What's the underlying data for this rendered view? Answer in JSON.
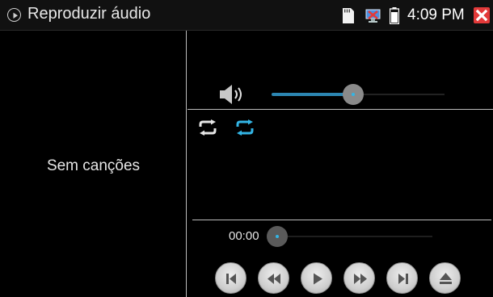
{
  "titlebar": {
    "title": "Reproduzir áudio",
    "clock": "4:09 PM",
    "icons": [
      "play-circle-icon",
      "sd-card-icon",
      "network-disconnected-icon",
      "battery-icon",
      "close-icon"
    ],
    "close_color": "#e33a3a"
  },
  "playlist": {
    "empty_text": "Sem canções"
  },
  "volume": {
    "level": 0.47,
    "accent": "#2c86b2"
  },
  "playback": {
    "current_time": "00:00",
    "progress": 0.0,
    "repeat_modes": [
      "repeat-icon",
      "repeat-all-icon"
    ],
    "active_mode_color": "#33b5e5"
  },
  "controls": [
    "previous-icon",
    "rewind-icon",
    "play-icon",
    "fast-forward-icon",
    "next-icon",
    "eject-icon"
  ]
}
